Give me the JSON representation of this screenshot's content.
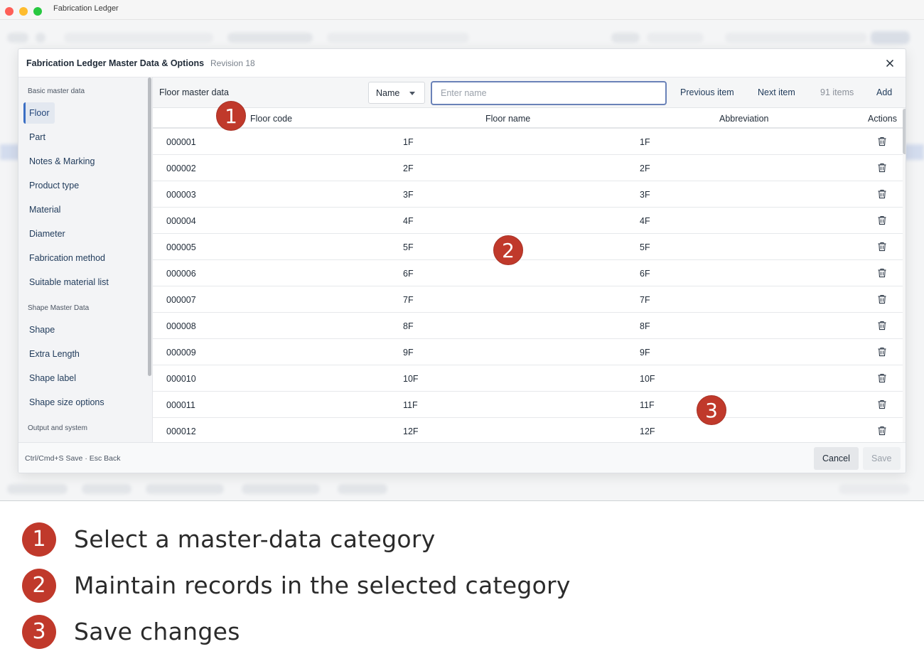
{
  "window": {
    "title": "Fabrication Ledger"
  },
  "modal": {
    "title": "Fabrication Ledger Master Data & Options",
    "revision": "Revision 18",
    "close_icon": "close-icon"
  },
  "sidebar": {
    "groups": [
      {
        "label": "Basic master data"
      },
      {
        "label": "Shape Master Data"
      },
      {
        "label": "Output and system"
      }
    ],
    "items": [
      {
        "label": "Floor",
        "active": true
      },
      {
        "label": "Part"
      },
      {
        "label": "Notes & Marking"
      },
      {
        "label": "Product type"
      },
      {
        "label": "Material"
      },
      {
        "label": "Diameter"
      },
      {
        "label": "Fabrication method"
      },
      {
        "label": "Suitable material list"
      },
      {
        "label": "Shape"
      },
      {
        "label": "Extra Length"
      },
      {
        "label": "Shape label"
      },
      {
        "label": "Shape size options"
      }
    ]
  },
  "toolbar": {
    "title": "Floor master data",
    "field_select": "Name",
    "search_placeholder": "Enter name",
    "search_value": "",
    "prev_label": "Previous item",
    "next_label": "Next item",
    "count": "91 items",
    "add_label": "Add"
  },
  "table": {
    "columns": [
      "Floor code",
      "Floor name",
      "Abbreviation",
      "Actions"
    ],
    "rows": [
      [
        "000001",
        "1F",
        "1F"
      ],
      [
        "000002",
        "2F",
        "2F"
      ],
      [
        "000003",
        "3F",
        "3F"
      ],
      [
        "000004",
        "4F",
        "4F"
      ],
      [
        "000005",
        "5F",
        "5F"
      ],
      [
        "000006",
        "6F",
        "6F"
      ],
      [
        "000007",
        "7F",
        "7F"
      ],
      [
        "000008",
        "8F",
        "8F"
      ],
      [
        "000009",
        "9F",
        "9F"
      ],
      [
        "000010",
        "10F",
        "10F"
      ],
      [
        "000011",
        "11F",
        "11F"
      ],
      [
        "000012",
        "12F",
        "12F"
      ]
    ],
    "row_action_icon": "trash-icon"
  },
  "footer": {
    "hint": "Ctrl/Cmd+S Save · Esc Back",
    "cancel_label": "Cancel",
    "save_label": "Save"
  },
  "callouts": [
    {
      "number": "1",
      "text": "Select a master-data category"
    },
    {
      "number": "2",
      "text": "Maintain records in the selected category"
    },
    {
      "number": "3",
      "text": "Save changes"
    }
  ],
  "colors": {
    "accent": "#3b6fc4",
    "badge": "#c0392b",
    "input_border": "#6a82b8"
  }
}
